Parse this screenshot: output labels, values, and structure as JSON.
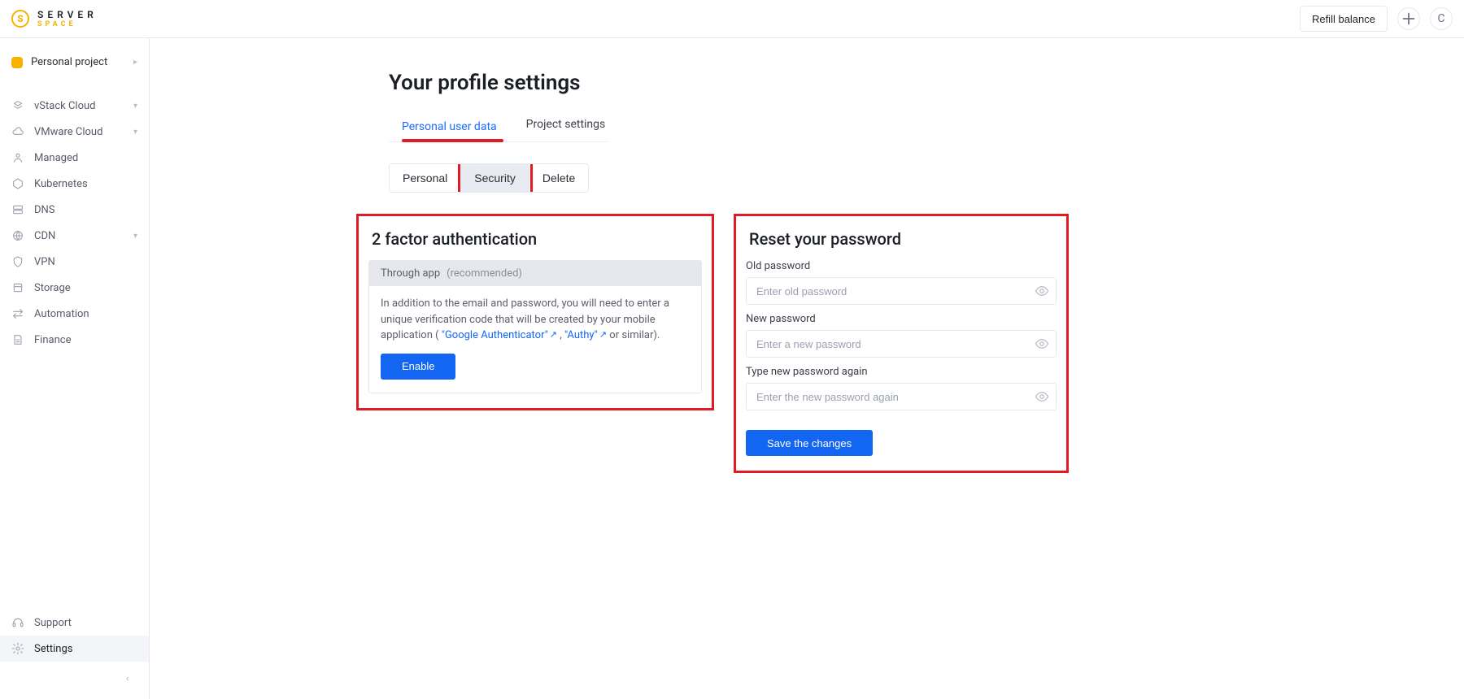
{
  "brand": {
    "line1": "SERVER",
    "line2": "SPACE"
  },
  "topbar": {
    "refill_label": "Refill balance",
    "avatar_initial": "C"
  },
  "sidebar": {
    "project_label": "Personal project",
    "items": [
      {
        "label": "vStack Cloud",
        "expandable": true
      },
      {
        "label": "VMware Cloud",
        "expandable": true
      },
      {
        "label": "Managed",
        "expandable": false
      },
      {
        "label": "Kubernetes",
        "expandable": false
      },
      {
        "label": "DNS",
        "expandable": false
      },
      {
        "label": "CDN",
        "expandable": true
      },
      {
        "label": "VPN",
        "expandable": false
      },
      {
        "label": "Storage",
        "expandable": false
      },
      {
        "label": "Automation",
        "expandable": false
      },
      {
        "label": "Finance",
        "expandable": false
      }
    ],
    "footer": {
      "support_label": "Support",
      "settings_label": "Settings"
    }
  },
  "page": {
    "title": "Your profile settings",
    "tabs": {
      "personal_user_data": "Personal user data",
      "project_settings": "Project settings",
      "active": "personal_user_data"
    },
    "segmented": {
      "personal": "Personal",
      "security": "Security",
      "delete": "Delete",
      "active": "security"
    },
    "twofa": {
      "heading": "2 factor authentication",
      "tab_label": "Through app",
      "tab_recommended": "(recommended)",
      "desc_prefix": "In addition to the email and password, you will need to enter a unique verification code that will be created by your mobile application ( ",
      "link_google": "\"Google Authenticator\"",
      "desc_mid": ", ",
      "link_authy": "\"Authy\"",
      "desc_suffix": " or similar).",
      "enable_label": "Enable"
    },
    "password": {
      "heading": "Reset your password",
      "fields": {
        "old": {
          "label": "Old password",
          "placeholder": "Enter old password"
        },
        "new": {
          "label": "New password",
          "placeholder": "Enter a new password"
        },
        "confirm": {
          "label": "Type new password again",
          "placeholder": "Enter the new password again"
        }
      },
      "save_label": "Save the changes"
    }
  },
  "colors": {
    "highlight": "#e11b24",
    "primary": "#1266f1",
    "accent": "#f8b200"
  }
}
